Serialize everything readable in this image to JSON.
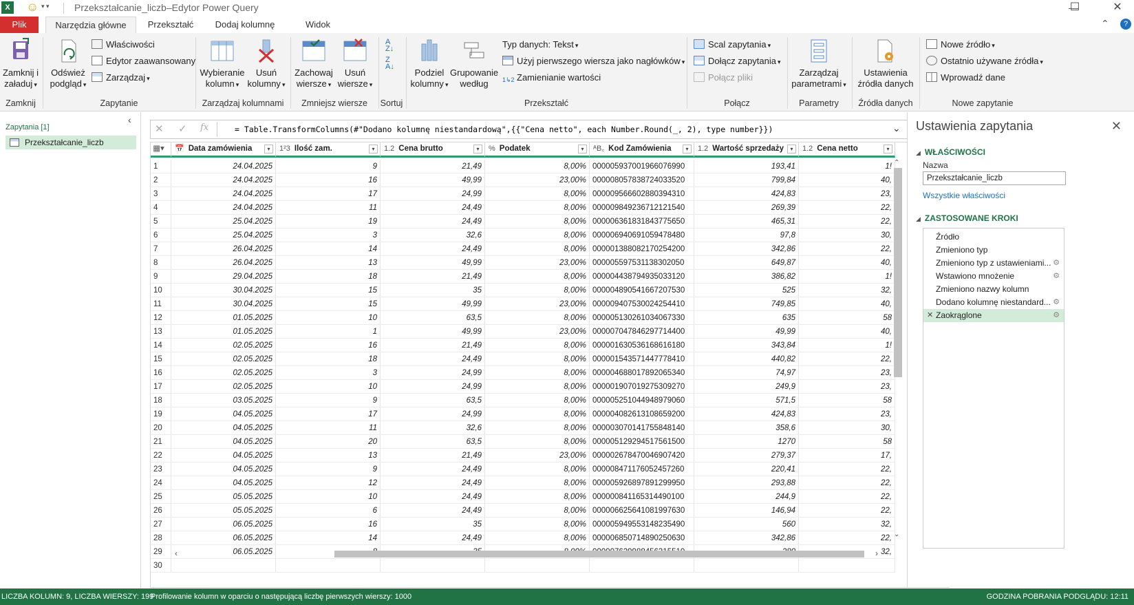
{
  "window": {
    "title": "Przekształcanie_liczb–Edytor Power Query",
    "smiley": "☺",
    "minimize": "—",
    "maximize": "☐",
    "close": "✕"
  },
  "tabs": [
    "Plik",
    "Narzędzia główne",
    "Przekształć",
    "Dodaj kolumnę",
    "Widok"
  ],
  "ribbon": {
    "close_load": [
      "Zamknij i",
      "załaduj"
    ],
    "refresh": [
      "Odśwież",
      "podgląd"
    ],
    "properties": "Właściwości",
    "advanced_editor": "Edytor zaawansowany",
    "manage": "Zarządzaj",
    "choose_columns": [
      "Wybieranie",
      "kolumn"
    ],
    "remove_columns": [
      "Usuń",
      "kolumny"
    ],
    "keep_rows": [
      "Zachowaj",
      "wiersze"
    ],
    "remove_rows": [
      "Usuń",
      "wiersze"
    ],
    "split_column": [
      "Podziel",
      "kolumny"
    ],
    "group_by": [
      "Grupowanie",
      "według"
    ],
    "data_type": "Typ danych: Tekst",
    "use_first_row": "Użyj pierwszego wiersza jako nagłówków",
    "replace_values": "Zamienianie wartości",
    "merge_queries": "Scal zapytania",
    "append_queries": "Dołącz zapytania",
    "combine_files": "Połącz pliki",
    "manage_params": [
      "Zarządzaj",
      "parametrami"
    ],
    "data_source_settings": [
      "Ustawienia",
      "źródła danych"
    ],
    "new_source": "Nowe źródło",
    "recent_sources": "Ostatnio używane źródła",
    "enter_data": "Wprowadź dane",
    "groups": {
      "close": "Zamknij",
      "query": "Zapytanie",
      "manage_columns": "Zarządzaj kolumnami",
      "reduce_rows": "Zmniejsz wiersze",
      "sort": "Sortuj",
      "transform": "Przekształć",
      "combine": "Połącz",
      "parameters": "Parametry",
      "data_sources": "Źródła danych",
      "new_query": "Nowe zapytanie"
    }
  },
  "queries": {
    "header": "Zapytania [1]",
    "item": "Przekształcanie_liczb"
  },
  "formula": "= Table.TransformColumns(#\"Dodano kolumnę niestandardową\",{{\"Cena netto\", each Number.Round(_, 2), type number}})",
  "formula_fx": "fx",
  "grid": {
    "columns": [
      {
        "type": "📅",
        "name": "Data zamówienia"
      },
      {
        "type": "1²3",
        "name": "Ilość zam."
      },
      {
        "type": "1.2",
        "name": "Cena brutto"
      },
      {
        "type": "%",
        "name": "Podatek"
      },
      {
        "type": "ᴬB꜀",
        "name": "Kod Zamówienia"
      },
      {
        "type": "1.2",
        "name": "Wartość sprzedaży"
      },
      {
        "type": "1.2",
        "name": "Cena netto"
      }
    ],
    "rows": [
      [
        "1",
        "24.04.2025",
        "9",
        "21,49",
        "8,00%",
        "000005937001966076990",
        "193,41",
        "1!"
      ],
      [
        "2",
        "24.04.2025",
        "16",
        "49,99",
        "23,00%",
        "000008057838724033520",
        "799,84",
        "40,"
      ],
      [
        "3",
        "24.04.2025",
        "17",
        "24,99",
        "8,00%",
        "000009566602880394310",
        "424,83",
        "23,"
      ],
      [
        "4",
        "24.04.2025",
        "11",
        "24,49",
        "8,00%",
        "000009849236712121540",
        "269,39",
        "22,"
      ],
      [
        "5",
        "25.04.2025",
        "19",
        "24,49",
        "8,00%",
        "000006361831843775650",
        "465,31",
        "22,"
      ],
      [
        "6",
        "25.04.2025",
        "3",
        "32,6",
        "8,00%",
        "000006940691059478480",
        "97,8",
        "30,"
      ],
      [
        "7",
        "26.04.2025",
        "14",
        "24,49",
        "8,00%",
        "000001388082170254200",
        "342,86",
        "22,"
      ],
      [
        "8",
        "26.04.2025",
        "13",
        "49,99",
        "23,00%",
        "000005597531138302050",
        "649,87",
        "40,"
      ],
      [
        "9",
        "29.04.2025",
        "18",
        "21,49",
        "8,00%",
        "000004438794935033120",
        "386,82",
        "1!"
      ],
      [
        "10",
        "30.04.2025",
        "15",
        "35",
        "8,00%",
        "000004890541667207530",
        "525",
        "32,"
      ],
      [
        "11",
        "30.04.2025",
        "15",
        "49,99",
        "23,00%",
        "000009407530024254410",
        "749,85",
        "40,"
      ],
      [
        "12",
        "01.05.2025",
        "10",
        "63,5",
        "8,00%",
        "000005130261034067330",
        "635",
        "58"
      ],
      [
        "13",
        "01.05.2025",
        "1",
        "49,99",
        "23,00%",
        "000007047846297714400",
        "49,99",
        "40,"
      ],
      [
        "14",
        "02.05.2025",
        "16",
        "21,49",
        "8,00%",
        "000001630536168616180",
        "343,84",
        "1!"
      ],
      [
        "15",
        "02.05.2025",
        "18",
        "24,49",
        "8,00%",
        "000001543571447778410",
        "440,82",
        "22,"
      ],
      [
        "16",
        "02.05.2025",
        "3",
        "24,99",
        "8,00%",
        "000004688017892065340",
        "74,97",
        "23,"
      ],
      [
        "17",
        "02.05.2025",
        "10",
        "24,99",
        "8,00%",
        "000001907019275309270",
        "249,9",
        "23,"
      ],
      [
        "18",
        "03.05.2025",
        "9",
        "63,5",
        "8,00%",
        "000005251044948979060",
        "571,5",
        "58"
      ],
      [
        "19",
        "04.05.2025",
        "17",
        "24,99",
        "8,00%",
        "000004082613108659200",
        "424,83",
        "23,"
      ],
      [
        "20",
        "04.05.2025",
        "11",
        "32,6",
        "8,00%",
        "000003070141755848140",
        "358,6",
        "30,"
      ],
      [
        "21",
        "04.05.2025",
        "20",
        "63,5",
        "8,00%",
        "000005129294517561500",
        "1270",
        "58"
      ],
      [
        "22",
        "04.05.2025",
        "13",
        "21,49",
        "23,00%",
        "000002678470046907420",
        "279,37",
        "17,"
      ],
      [
        "23",
        "04.05.2025",
        "9",
        "24,49",
        "8,00%",
        "000008471176052457260",
        "220,41",
        "22,"
      ],
      [
        "24",
        "04.05.2025",
        "12",
        "24,49",
        "8,00%",
        "000005926897891299950",
        "293,88",
        "22,"
      ],
      [
        "25",
        "05.05.2025",
        "10",
        "24,49",
        "8,00%",
        "000000841165314490100",
        "244,9",
        "22,"
      ],
      [
        "26",
        "05.05.2025",
        "6",
        "24,49",
        "8,00%",
        "000006625641081997630",
        "146,94",
        "22,"
      ],
      [
        "27",
        "06.05.2025",
        "16",
        "35",
        "8,00%",
        "000005949553148235490",
        "560",
        "32,"
      ],
      [
        "28",
        "06.05.2025",
        "14",
        "24,49",
        "8,00%",
        "000006850714890250630",
        "342,86",
        "22,"
      ],
      [
        "29",
        "06.05.2025",
        "8",
        "35",
        "8,00%",
        "000007629988456315510",
        "280",
        "32,"
      ],
      [
        "30",
        "",
        "",
        "",
        "",
        "",
        "",
        ""
      ]
    ]
  },
  "settings": {
    "title": "Ustawienia zapytania",
    "close": "✕",
    "properties_title": "WŁAŚCIWOŚCI",
    "name_label": "Nazwa",
    "name_value": "Przekształcanie_liczb",
    "all_properties": "Wszystkie właściwości",
    "steps_title": "ZASTOSOWANE KROKI",
    "steps": [
      {
        "label": "Źródło",
        "gear": false
      },
      {
        "label": "Zmieniono typ",
        "gear": false
      },
      {
        "label": "Zmieniono typ z ustawieniami...",
        "gear": true
      },
      {
        "label": "Wstawiono mnożenie",
        "gear": true
      },
      {
        "label": "Zmieniono nazwy kolumn",
        "gear": false
      },
      {
        "label": "Dodano kolumnę niestandard...",
        "gear": true
      },
      {
        "label": "Zaokrąglone",
        "gear": true,
        "selected": true
      }
    ]
  },
  "status": {
    "columns_rows": "LICZBA KOLUMN: 9, LICZBA WIERSZY: 199",
    "profiling": "Profilowanie kolumn w oparciu o następującą liczbę pierwszych wierszy: 1000",
    "preview_time": "GODZINA POBRANIA PODGLĄDU: 12:11"
  },
  "colors": {
    "accent": "#217346",
    "file_tab": "#d32f2f",
    "selected": "#d3ecd9"
  }
}
